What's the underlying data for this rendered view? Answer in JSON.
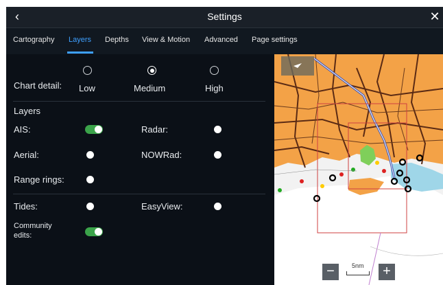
{
  "header": {
    "title": "Settings",
    "back_icon": "‹",
    "close_icon": "✕"
  },
  "tabs": [
    {
      "label": "Cartography",
      "active": false
    },
    {
      "label": "Layers",
      "active": true
    },
    {
      "label": "Depths",
      "active": false
    },
    {
      "label": "View & Motion",
      "active": false
    },
    {
      "label": "Advanced",
      "active": false
    },
    {
      "label": "Page settings",
      "active": false
    }
  ],
  "chart_detail": {
    "label": "Chart detail:",
    "options": [
      {
        "label": "Low",
        "selected": false
      },
      {
        "label": "Medium",
        "selected": true
      },
      {
        "label": "High",
        "selected": false
      }
    ]
  },
  "layers": {
    "heading": "Layers",
    "ais": {
      "label": "AIS:",
      "on": true
    },
    "radar": {
      "label": "Radar:",
      "on": false
    },
    "aerial": {
      "label": "Aerial:",
      "on": false
    },
    "nowrad": {
      "label": "NOWRad:",
      "on": false
    },
    "range_rings": {
      "label": "Range rings:",
      "on": false
    },
    "tides": {
      "label": "Tides:",
      "on": false
    },
    "easyview": {
      "label": "EasyView:",
      "on": false
    },
    "community_edits": {
      "label_line1": "Community",
      "label_line2": "edits:",
      "on": true
    }
  },
  "map": {
    "zoom_out_label": "−",
    "zoom_in_label": "+",
    "scale_label": "5nm",
    "colors": {
      "land": "#f3a247",
      "water": "#f2f2f2",
      "shallow": "#9fd6e8",
      "road": "#5a2a14"
    }
  },
  "colors": {
    "accent": "#3ea0ff",
    "toggle_on": "#3ba34a",
    "background": "#0b1017"
  }
}
